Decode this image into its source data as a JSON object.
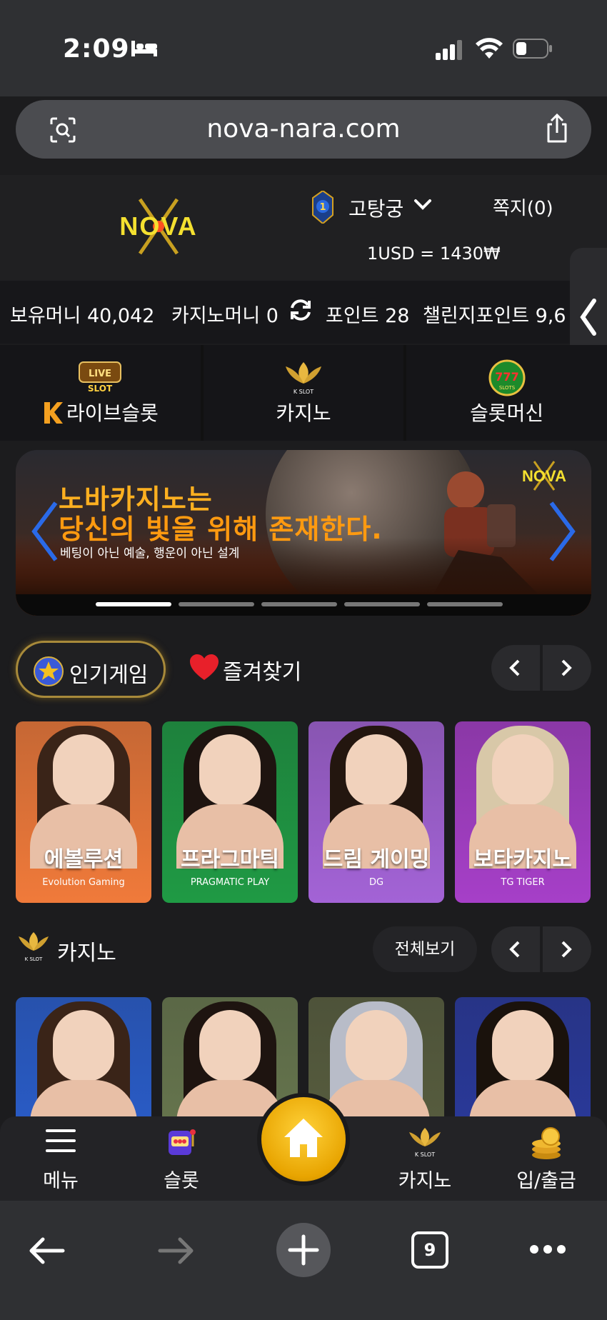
{
  "status": {
    "time": "2:09"
  },
  "browser": {
    "url": "nova-nara.com",
    "tab_count": "9"
  },
  "header": {
    "logo_text": "NOVA",
    "level": "1",
    "username": "고탕궁",
    "message": "쪽지(0)",
    "rate": "1USD = 1430₩"
  },
  "balance": {
    "money": "보유머니 40,042",
    "casino_money": "카지노머니 0",
    "points": "포인트 28",
    "challenge_points": "챌린지포인트 9,6"
  },
  "categories": [
    {
      "label": "라이브슬롯",
      "badge": "LIVE SLOT",
      "icon": "live-slot-icon"
    },
    {
      "label": "카지노",
      "badge": "K SLOT",
      "icon": "k-slot-icon"
    },
    {
      "label": "슬롯머신",
      "badge": "777 SLOTS",
      "icon": "slots-777-icon"
    }
  ],
  "banner": {
    "title_line1": "노바카지노는",
    "title_line2": "당신의 빛을 위해 존재한다.",
    "subtitle": "베팅이 아닌 예술, 행운이 아닌 설계",
    "logo": "NOVA",
    "slide_count": 5,
    "active_slide": 1
  },
  "popular": {
    "tab_label": "인기게임",
    "fav_label": "즐겨찾기",
    "games": [
      {
        "title": "에볼루션",
        "provider": "Evolution Gaming",
        "bg": "#f07a3a",
        "hair": "#3a2418"
      },
      {
        "title": "프라그마틱",
        "provider": "PRAGMATIC PLAY",
        "bg": "#1f9a44",
        "hair": "#1e1410"
      },
      {
        "title": "드림 게이밍",
        "provider": "DG",
        "bg": "#a363d6",
        "hair": "#23160f"
      },
      {
        "title": "보타카지노",
        "provider": "TG TIGER",
        "bg": "#a63fc8",
        "hair": "#d8c8a8"
      }
    ]
  },
  "casino_section": {
    "title": "카지노",
    "view_all": "전체보기",
    "icon_badge": "K SLOT",
    "games": [
      {
        "bg": "#2a5fd0",
        "hair": "#3a2418"
      },
      {
        "bg": "#6a7a50",
        "hair": "#1e1410"
      },
      {
        "bg": "#5a6040",
        "hair": "#b8bcc8"
      },
      {
        "bg": "#2a3aa0",
        "hair": "#1a120c"
      }
    ]
  },
  "app_nav": {
    "menu": "메뉴",
    "slot": "슬롯",
    "casino": "카지노",
    "deposit": "입/출금",
    "casino_badge": "K SLOT"
  }
}
